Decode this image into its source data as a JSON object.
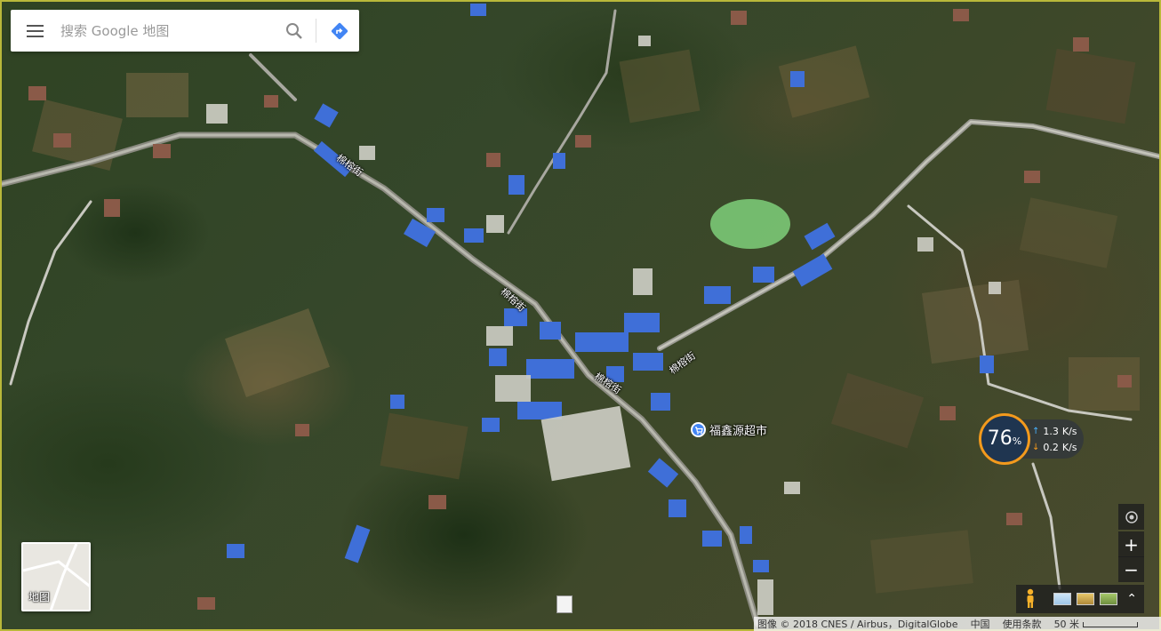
{
  "search": {
    "placeholder": "搜索 Google 地图"
  },
  "icons": {
    "menu": "hamburger-menu-icon",
    "search": "magnifier-icon",
    "directions": "directions-diamond-icon",
    "location": "my-location-icon",
    "pegman": "street-view-pegman-icon",
    "expand": "expand-chevrons-icon",
    "poi": "shopping-cart-icon"
  },
  "map": {
    "street_labels": [
      "棉榕街",
      "棉榕街",
      "棉榕街",
      "棉榕街"
    ],
    "poi_label": "福鑫源超市"
  },
  "layer_toggle": {
    "label": "地图"
  },
  "network_widget": {
    "percent": "76",
    "percent_sign": "%",
    "upload": "1.3",
    "upload_unit": "K/s",
    "download": "0.2",
    "download_unit": "K/s"
  },
  "controls": {
    "zoom_in": "+",
    "zoom_out": "−"
  },
  "footer": {
    "attribution": "图像 © 2018 CNES / Airbus，DigitalGlobe",
    "region": "中国",
    "terms": "使用条款",
    "scale": "50 米"
  },
  "colors": {
    "accent_blue": "#4285f4",
    "roof_blue": "#3f6fd8",
    "widget_orange": "#f39a1d",
    "widget_circle": "#1f3550",
    "frame": "#b9b83a"
  }
}
